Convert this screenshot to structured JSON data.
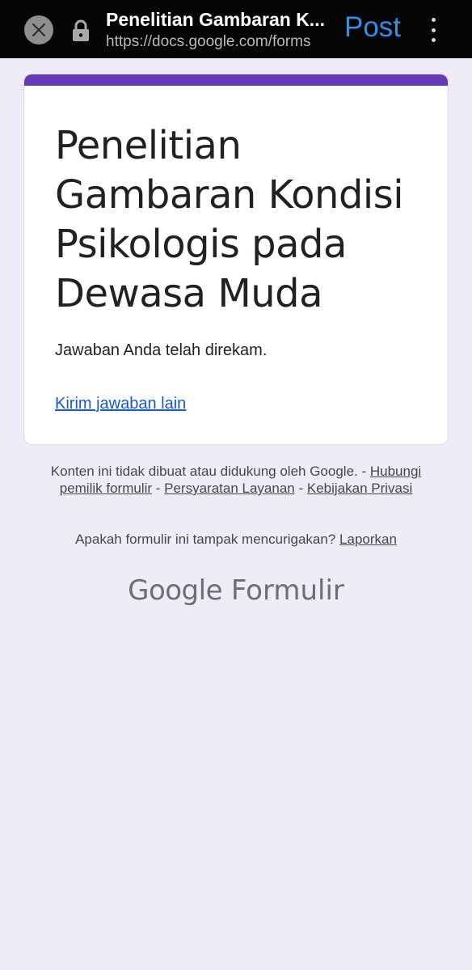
{
  "browser": {
    "page_title": "Penelitian Gambaran K...",
    "url": "https://docs.google.com/forms",
    "post_label": "Post"
  },
  "form": {
    "title": "Penelitian Gambaran Kondisi Psikologis pada Dewasa Muda",
    "confirmation": "Jawaban Anda telah direkam.",
    "resubmit_link": "Kirim jawaban lain"
  },
  "footer": {
    "disclaimer": "Konten ini tidak dibuat atau didukung oleh Google.",
    "link_owner": "Hubungi pemilik formulir",
    "link_terms": "Persyaratan Layanan",
    "link_privacy": "Kebijakan Privasi",
    "report_question": "Apakah formulir ini tampak mencurigakan?",
    "report_link": "Laporkan"
  },
  "brand": {
    "google": "Google",
    "product": "Formulir"
  },
  "colors": {
    "accent": "#673ab7",
    "background": "#efebf8",
    "link": "#1a57c9",
    "post": "#2f8ee8"
  }
}
